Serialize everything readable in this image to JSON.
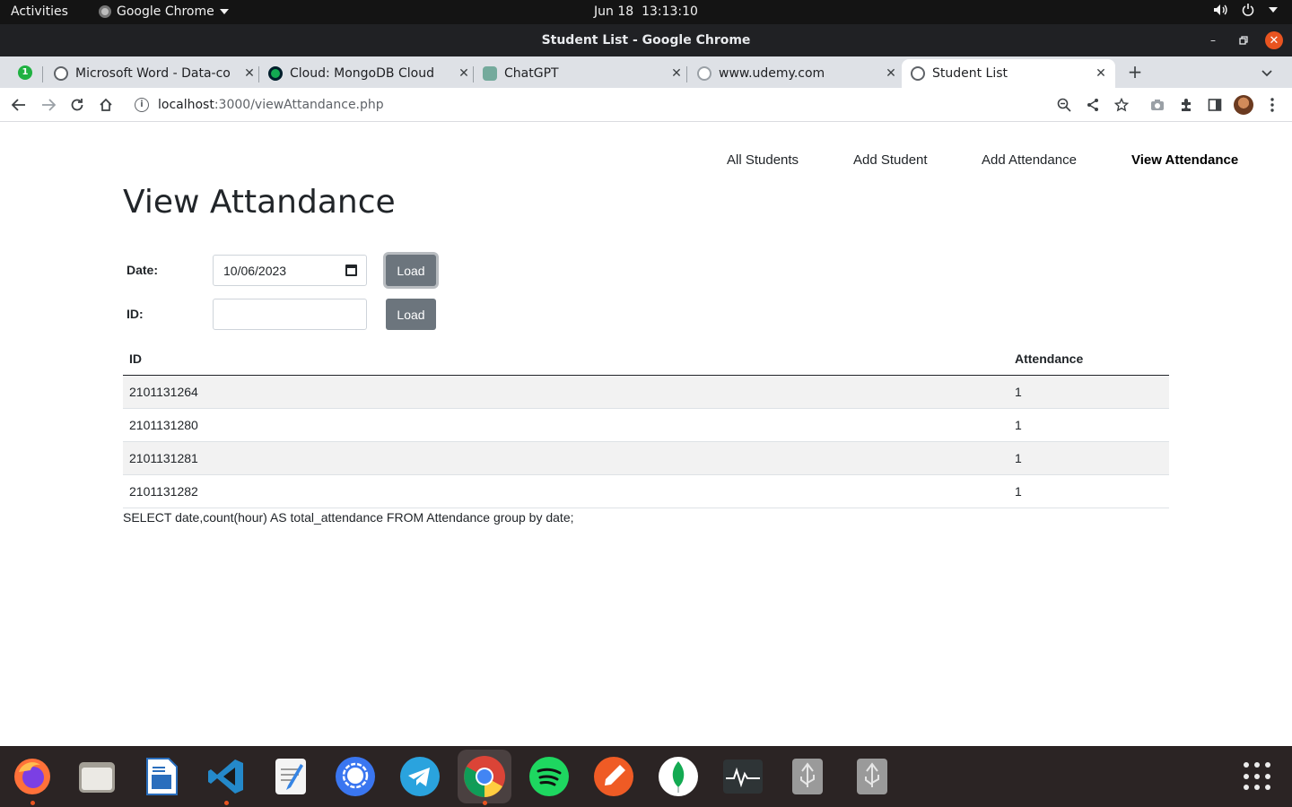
{
  "system": {
    "activities": "Activities",
    "app_menu": "Google Chrome",
    "date": "Jun 18",
    "time": "13:13:10"
  },
  "window": {
    "title": "Student List - Google Chrome"
  },
  "tabs": [
    {
      "label": "Microsoft Word - Data-co",
      "icon": "globe-icon"
    },
    {
      "label": "Cloud: MongoDB Cloud",
      "icon": "mongodb-leaf-icon"
    },
    {
      "label": "ChatGPT",
      "icon": "chatgpt-icon"
    },
    {
      "label": "www.udemy.com",
      "icon": "info-icon"
    },
    {
      "label": "Student List",
      "icon": "globe-icon",
      "active": true
    }
  ],
  "tab_badge": "1",
  "omnibox": {
    "host": "localhost",
    "path": ":3000/viewAttandance.php"
  },
  "nav": {
    "all_students": "All Students",
    "add_student": "Add Student",
    "add_attendance": "Add Attendance",
    "view_attendance": "View Attendance"
  },
  "heading": "View Attandance",
  "form": {
    "date_label": "Date:",
    "date_value": "10/06/2023",
    "id_label": "ID:",
    "id_value": "",
    "load_label": "Load"
  },
  "table": {
    "headers": [
      "ID",
      "Attendance"
    ],
    "rows": [
      {
        "id": "2101131264",
        "attendance": "1"
      },
      {
        "id": "2101131280",
        "attendance": "1"
      },
      {
        "id": "2101131281",
        "attendance": "1"
      },
      {
        "id": "2101131282",
        "attendance": "1"
      }
    ]
  },
  "sql": "SELECT date,count(hour) AS total_attendance FROM Attendance group by date;",
  "dock": [
    "firefox-icon",
    "files-icon",
    "libreoffice-writer-icon",
    "vscode-icon",
    "text-editor-icon",
    "signal-icon",
    "telegram-icon",
    "chrome-icon",
    "spotify-icon",
    "postman-icon",
    "mongodb-compass-icon",
    "system-monitor-icon",
    "usb-drive-icon",
    "usb-drive-icon"
  ],
  "colors": {
    "button": "#6c757d",
    "close_button": "#e95420",
    "topbar": "#141414",
    "tabstrip": "#dee1e6"
  }
}
